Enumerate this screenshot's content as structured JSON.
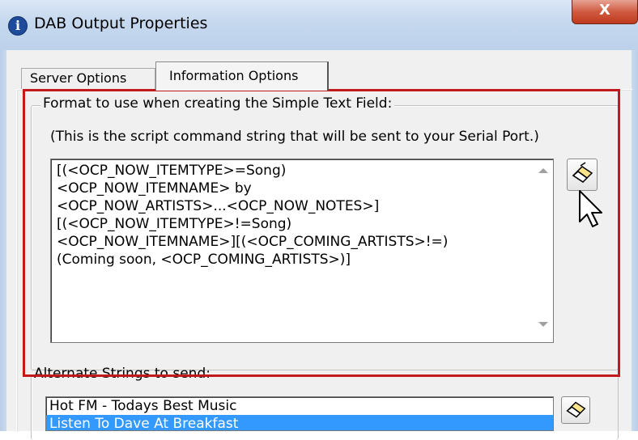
{
  "window": {
    "title": "DAB Output Properties",
    "close_glyph": "X",
    "info_icon_glyph": "i"
  },
  "tabs": [
    {
      "label": "Server Options",
      "selected": false
    },
    {
      "label": "Information Options",
      "selected": true
    }
  ],
  "format_group": {
    "legend": "Format to use when creating the Simple Text Field:",
    "help_text": "(This is the script command string that will be sent to your Serial Port.)",
    "script_value": "[(<OCP_NOW_ITEMTYPE>=Song)\n<OCP_NOW_ITEMNAME> by\n<OCP_NOW_ARTISTS>...<OCP_NOW_NOTES>]\n[(<OCP_NOW_ITEMTYPE>!=Song)\n<OCP_NOW_ITEMNAME>][(<OCP_COMING_ARTISTS>!=)\n(Coming soon, <OCP_COMING_ARTISTS>)]",
    "edit_button_icon": "eraser-icon"
  },
  "alternate_group": {
    "legend": "Alternate Strings to send:",
    "items": [
      {
        "label": "Hot FM - Todays Best Music",
        "selected": false
      },
      {
        "label": "Listen To Dave At Breakfast",
        "selected": true
      }
    ],
    "edit_button_icon": "eraser-icon"
  },
  "annotation": {
    "highlight_color": "#c21a1a"
  },
  "colors": {
    "titlebar": "#c5d8ee",
    "close_button": "#c0391d",
    "dialog_bg": "#f0f0f0",
    "selection": "#3399ff"
  }
}
